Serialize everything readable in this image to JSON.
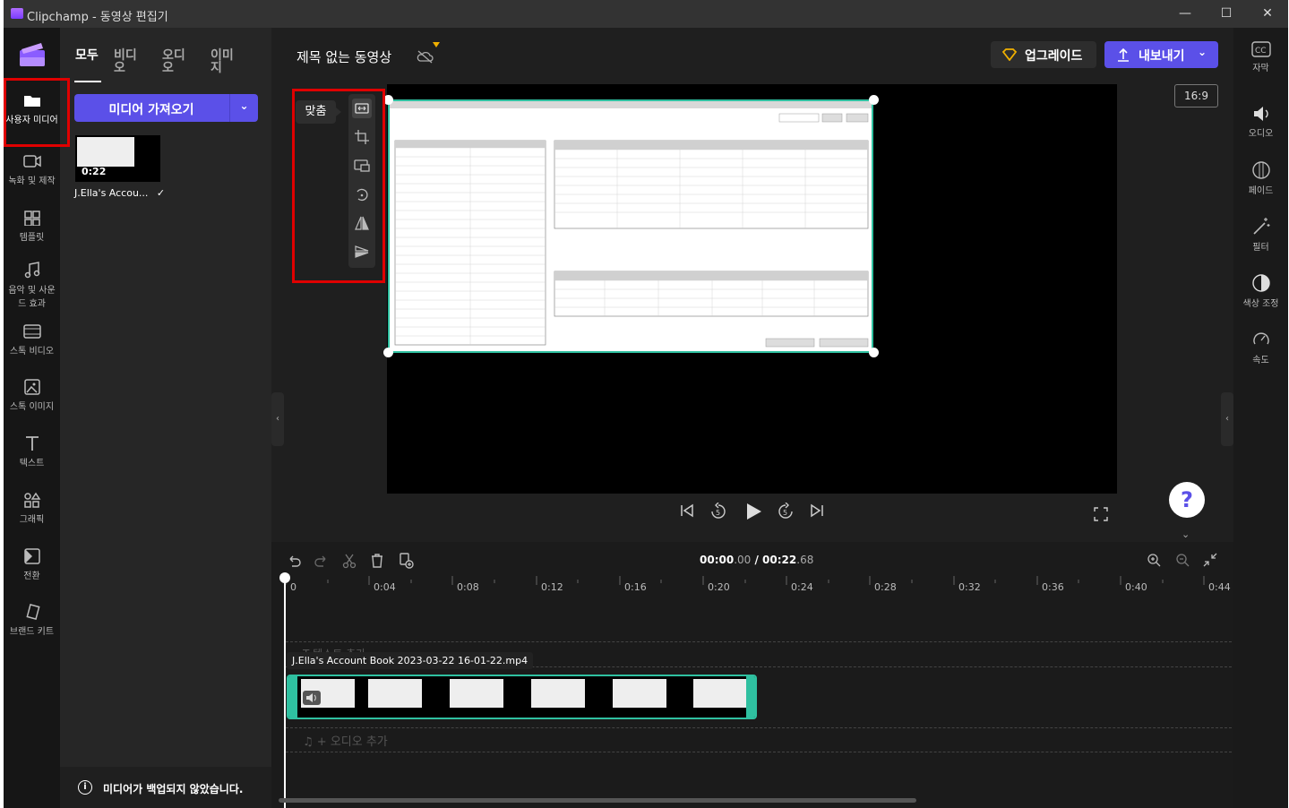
{
  "window": {
    "title": "Clipchamp - 동영상 편집기"
  },
  "rail": [
    {
      "label": "사용자 미디어",
      "icon": "folder-icon"
    },
    {
      "label": "녹화 및 제작",
      "icon": "camera-icon"
    },
    {
      "label": "템플릿",
      "icon": "template-icon"
    },
    {
      "label": "음악 및 사운드 효과",
      "icon": "music-icon"
    },
    {
      "label": "스톡 비디오",
      "icon": "film-icon"
    },
    {
      "label": "스톡 이미지",
      "icon": "image-icon"
    },
    {
      "label": "텍스트",
      "icon": "text-icon"
    },
    {
      "label": "그래픽",
      "icon": "shapes-icon"
    },
    {
      "label": "전환",
      "icon": "transition-icon"
    },
    {
      "label": "브랜드 키트",
      "icon": "brand-icon"
    }
  ],
  "media": {
    "tabs": [
      "모두",
      "비디오",
      "오디오",
      "이미지"
    ],
    "import_label": "미디어 가져오기",
    "item": {
      "duration": "0:22",
      "name": "J.Ella's Accou..."
    },
    "backup_text": "미디어가 백업되지 않았습니다."
  },
  "header": {
    "video_title": "제목 없는 동영상",
    "upgrade_label": "업그레이드",
    "export_label": "내보내기"
  },
  "preview": {
    "ratio": "16:9",
    "fit_label": "맞춤"
  },
  "timeline": {
    "current": "00:00",
    "current_ms": ".00",
    "total": "00:22",
    "total_ms": ".68",
    "ruler": [
      "0",
      "0:04",
      "0:08",
      "0:12",
      "0:16",
      "0:20",
      "0:24",
      "0:28",
      "0:32",
      "0:36",
      "0:40",
      "0:44"
    ],
    "clip_name": "J.Ella's Account Book 2023-03-22 16-01-22.mp4",
    "text_add": "T  텍스트 추가",
    "audio_add": "+ 오디오 추가"
  },
  "right_rail": [
    {
      "label": "자막",
      "icon": "cc-icon"
    },
    {
      "label": "오디오",
      "icon": "speaker-icon"
    },
    {
      "label": "페이드",
      "icon": "fade-icon"
    },
    {
      "label": "필터",
      "icon": "wand-icon"
    },
    {
      "label": "색상 조정",
      "icon": "contrast-icon"
    },
    {
      "label": "속도",
      "icon": "speed-icon"
    }
  ],
  "colors": {
    "accent": "#5b50e8",
    "selection": "#2fc0a0",
    "highlight": "#e00000"
  }
}
